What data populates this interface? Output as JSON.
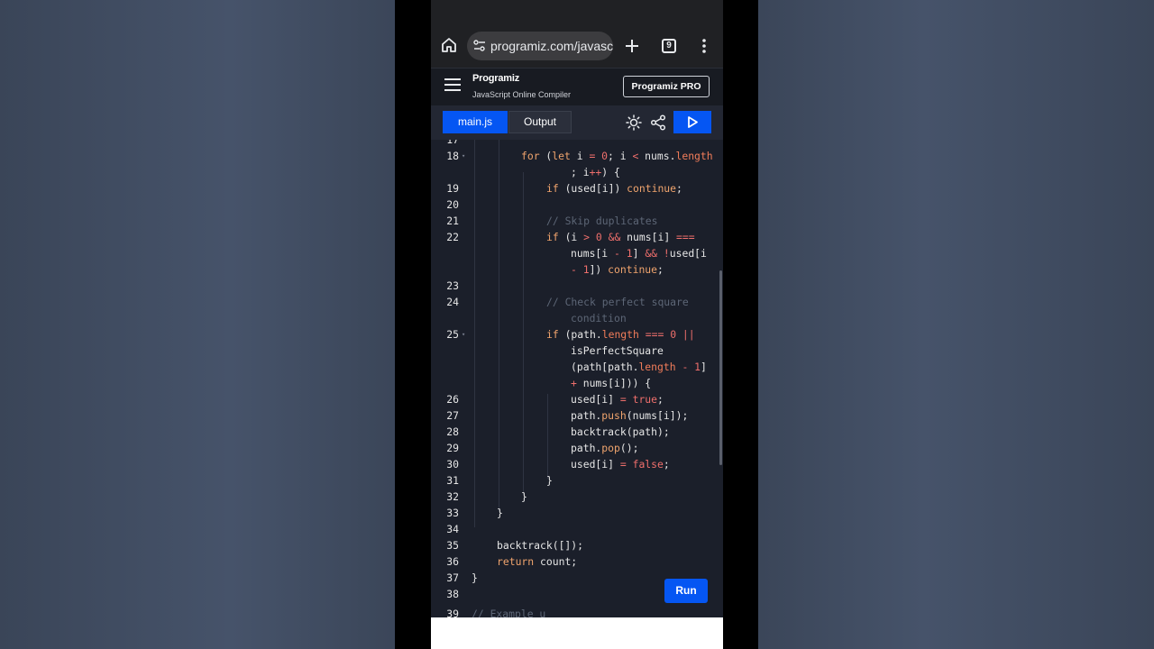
{
  "browser": {
    "url": "programiz.com/javasc",
    "tab_count": "9"
  },
  "header": {
    "logo": "Programiz",
    "subtitle": "JavaScript Online Compiler",
    "pro_button": "Programiz PRO"
  },
  "toolbar": {
    "tab_main": "main.js",
    "tab_output": "Output"
  },
  "editor": {
    "run_button": "Run",
    "partial_top_line": "17",
    "partial_bottom_line": "39",
    "partial_bottom_text": "// Example u"
  },
  "icons": [
    "home-icon",
    "tune-icon",
    "plus-icon",
    "tabs-icon",
    "more-vert-icon",
    "menu-icon",
    "sun-icon",
    "share-icon",
    "play-icon"
  ],
  "colors": {
    "accent": "#0556f3",
    "editor_bg": "#1b1f2a",
    "keyword": "#f0a46d",
    "operator": "#ef6f6c",
    "comment": "#5d6676"
  }
}
